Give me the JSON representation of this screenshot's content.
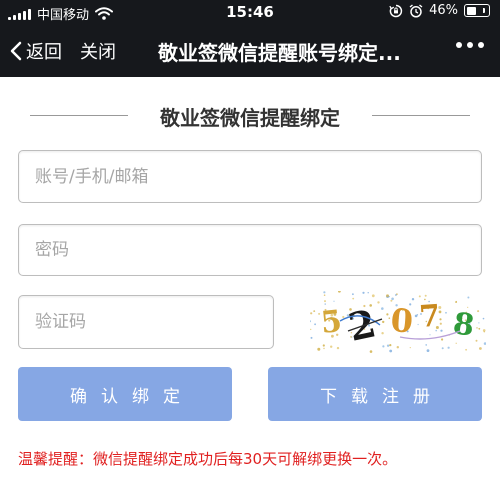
{
  "status_bar": {
    "carrier": "中国移动",
    "time": "15:46",
    "battery_percent": "46%",
    "battery_level": 0.46
  },
  "nav": {
    "back_label": "返回",
    "close_label": "关闭",
    "title": "敬业签微信提醒账号绑定..."
  },
  "form": {
    "section_title": "敬业签微信提醒绑定",
    "account_placeholder": "账号/手机/邮箱",
    "password_placeholder": "密码",
    "captcha_placeholder": "验证码",
    "captcha_text": "52078"
  },
  "buttons": {
    "confirm_bind": "确认绑定",
    "download_register": "下载注册"
  },
  "tip": "温馨提醒：微信提醒绑定成功后每30天可解绑更换一次。",
  "colors": {
    "top_bar": "#16181c",
    "button": "#86a7e4",
    "tip_text": "#e02020"
  }
}
